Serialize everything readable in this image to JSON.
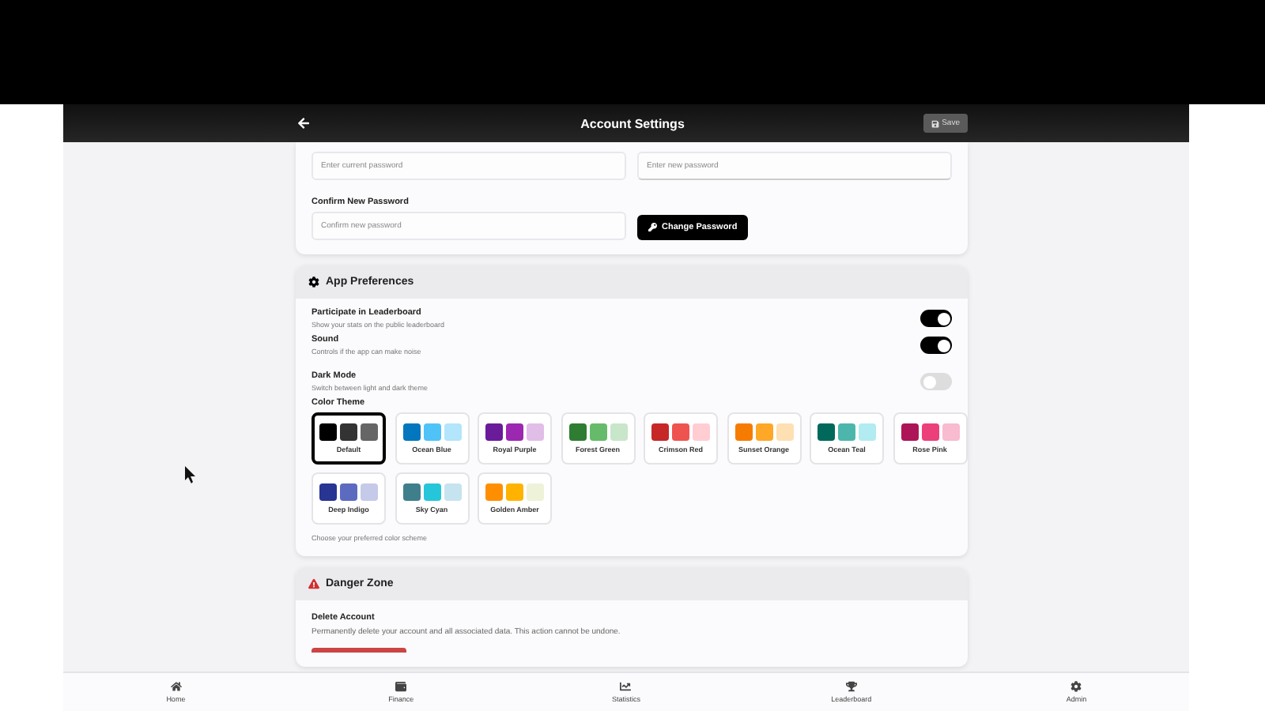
{
  "header": {
    "title": "Account Settings",
    "save": "Save"
  },
  "password": {
    "current_placeholder": "Enter current password",
    "new_placeholder": "Enter new password",
    "confirm_label": "Confirm New Password",
    "confirm_placeholder": "Confirm new password",
    "button": "Change Password"
  },
  "preferences": {
    "title": "App Preferences",
    "toggles": [
      {
        "label": "Participate in Leaderboard",
        "hint": "Show your stats on the public leaderboard",
        "on": true
      },
      {
        "label": "Sound",
        "hint": "Controls if the app can make noise",
        "on": true
      },
      {
        "label": "Dark Mode",
        "hint": "Switch between light and dark theme",
        "on": false
      }
    ],
    "theme_label": "Color Theme",
    "themes": [
      {
        "name": "Default",
        "selected": true,
        "swatches": [
          {
            "color": "#000000"
          },
          {
            "color": "#333333"
          },
          {
            "color": "#666666"
          }
        ]
      },
      {
        "name": "Ocean Blue",
        "selected": false,
        "swatches": [
          {
            "color": "#0277bd"
          },
          {
            "color": "#4fc3f7"
          },
          {
            "color": "#b3e5fc"
          }
        ]
      },
      {
        "name": "Royal Purple",
        "selected": false,
        "swatches": [
          {
            "color": "#6a1b9a"
          },
          {
            "color": "#9c27b0"
          },
          {
            "color": "#e1bee7"
          }
        ]
      },
      {
        "name": "Forest Green",
        "selected": false,
        "swatches": [
          {
            "color": "#2e7d32"
          },
          {
            "color": "#66bb6a"
          },
          {
            "color": "#c8e6c9"
          }
        ]
      },
      {
        "name": "Crimson Red",
        "selected": false,
        "swatches": [
          {
            "color": "#c62828"
          },
          {
            "color": "#ef5350"
          },
          {
            "color": "#ffcdd2"
          }
        ]
      },
      {
        "name": "Sunset Orange",
        "selected": false,
        "swatches": [
          {
            "color": "#f57c00"
          },
          {
            "color": "#ffa726"
          },
          {
            "color": "#ffe0b2"
          }
        ]
      },
      {
        "name": "Ocean Teal",
        "selected": false,
        "swatches": [
          {
            "color": "#00695c"
          },
          {
            "color": "#4db6ac"
          },
          {
            "color": "#b2ebf2"
          }
        ]
      },
      {
        "name": "Rose Pink",
        "selected": false,
        "swatches": [
          {
            "color": "#ad1457"
          },
          {
            "color": "#ec407a"
          },
          {
            "color": "#f8bbd0"
          }
        ]
      },
      {
        "name": "Deep Indigo",
        "selected": false,
        "swatches": [
          {
            "color": "#283593"
          },
          {
            "color": "#5c6bc0"
          },
          {
            "color": "#c5cae9"
          }
        ]
      },
      {
        "name": "Sky Cyan",
        "selected": false,
        "swatches": [
          {
            "color": "#3f7f8c"
          },
          {
            "color": "#26c6da"
          },
          {
            "color": "#c6e4f0"
          }
        ]
      },
      {
        "name": "Golden Amber",
        "selected": false,
        "swatches": [
          {
            "color": "#ff8f00"
          },
          {
            "color": "#ffb300"
          },
          {
            "color": "#eef2d8"
          }
        ]
      }
    ],
    "theme_hint": "Choose your preferred color scheme"
  },
  "danger": {
    "title": "Danger Zone",
    "label": "Delete Account",
    "description": "Permanently delete your account and all associated data. This action cannot be undone."
  },
  "nav": [
    {
      "kind": "home",
      "label": "Home"
    },
    {
      "kind": "wallet",
      "label": "Finance"
    },
    {
      "kind": "chart",
      "label": "Statistics"
    },
    {
      "kind": "trophy",
      "label": "Leaderboard"
    },
    {
      "kind": "gear",
      "label": "Admin"
    }
  ]
}
